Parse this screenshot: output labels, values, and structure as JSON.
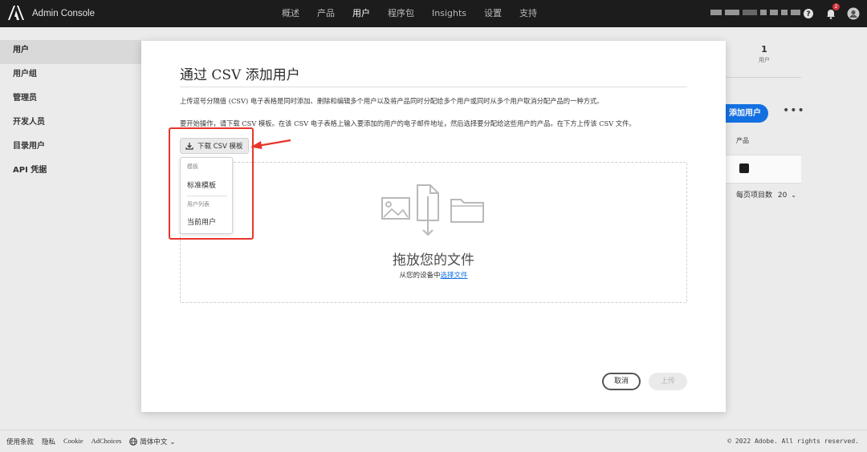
{
  "header": {
    "app_title": "Admin Console",
    "nav": [
      "概述",
      "产品",
      "用户",
      "程序包",
      "Insights",
      "设置",
      "支持"
    ],
    "active_nav": "用户",
    "notification_count": "2",
    "icons": [
      "adobe-logo-icon",
      "help-icon",
      "bell-icon",
      "user-avatar-icon"
    ]
  },
  "sidebar": {
    "items": [
      {
        "label": "用户",
        "active": true
      },
      {
        "label": "用户组"
      },
      {
        "label": "管理员"
      },
      {
        "label": "开发人员"
      },
      {
        "label": "目录用户"
      },
      {
        "label": "API 凭据"
      }
    ]
  },
  "right_panel": {
    "count": "1",
    "count_label": "用户",
    "add_button": "添加用户",
    "more": "•••",
    "product_header": "产品",
    "per_page_label": "每页项目数",
    "per_page_value": "20"
  },
  "modal": {
    "title": "通过 CSV 添加用户",
    "description": "上传逗号分隔值 (CSV) 电子表格是同时添加、删除和编辑多个用户以及将产品同时分配给多个用户或同时从多个用户取消分配产品的一种方式。",
    "instructions": "要开始操作，请下载 CSV 模板。在该 CSV 电子表格上输入要添加的用户的电子邮件地址，然后选择要分配给这些用户的产品。在下方上传该 CSV 文件。",
    "download_button": "下载 CSV 模板",
    "menu": {
      "section1": "模板",
      "item1": "标准模板",
      "section2": "用户列表",
      "item2": "当前用户"
    },
    "drop_title": "拖放您的文件",
    "drop_sub_prefix": "从您的设备中",
    "drop_sub_link": "选择文件",
    "cancel": "取消",
    "upload": "上传"
  },
  "footer": {
    "links": [
      "使用条款",
      "隐私",
      "Cookie",
      "AdChoices",
      "简体中文"
    ],
    "copyright": "© 2022 Adobe. All rights reserved."
  },
  "colors": {
    "accent": "#1473e6",
    "annotation": "#e8352b",
    "topbar": "#1d1d1d"
  }
}
